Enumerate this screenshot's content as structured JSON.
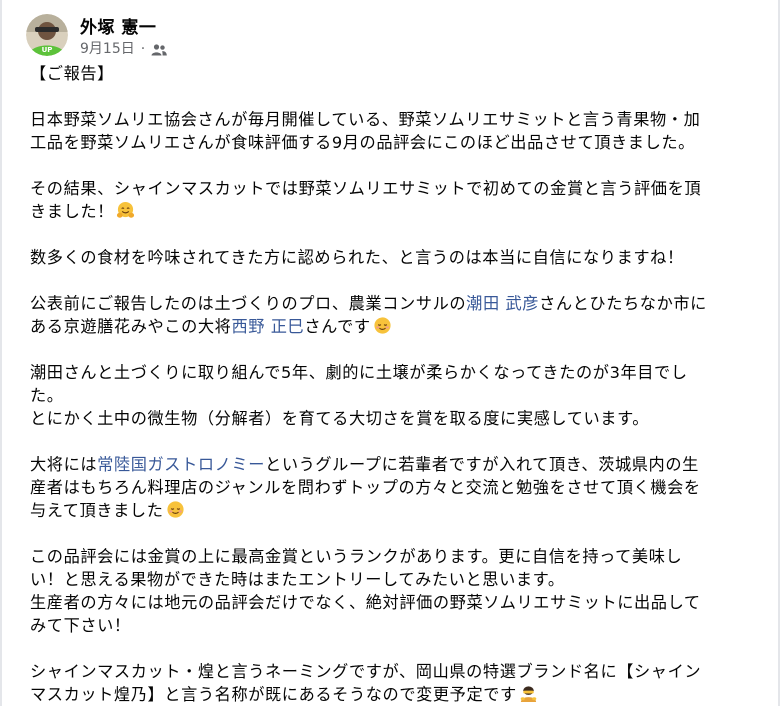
{
  "post": {
    "author": "外塚 憲一",
    "date": "9月15日",
    "separator": "·",
    "audience_icon": "friends-icon",
    "avatar_badge": "UP"
  },
  "content": {
    "p0": "【ご報告】",
    "p1a": "日本野菜ソムリエ協会さんが毎月開催している、野菜ソムリエサミットと言う青果物・加",
    "p1b": "工品を野菜ソムリエさんが食味評価する9月の品評会にこのほど出品させて頂きました。",
    "p2a": "その結果、シャインマスカットでは野菜ソムリエサミットで初めての金賞と言う評価を頂",
    "p2b": "きました！",
    "p3": "数多くの食材を吟味されてきた方に認められた、と言うのは本当に自信になりますね！",
    "p4a_pre": "公表前にご報告したのは土づくりのプロ、農業コンサルの",
    "p4a_link": "潮田 武彦",
    "p4a_post": "さんとひたちなか市に",
    "p4b_pre": "ある京遊膳花みやこの大将",
    "p4b_link": "西野 正巳",
    "p4b_post": "さんです",
    "p5a": "潮田さんと土づくりに取り組んで5年、劇的に土壌が柔らかくなってきたのが3年目でし",
    "p5b": "た。",
    "p5c": "とにかく土中の微生物（分解者）を育てる大切さを賞を取る度に実感しています。",
    "p6a_pre": "大将には",
    "p6a_link": "常陸国ガストロノミー",
    "p6a_post": "というグループに若輩者ですが入れて頂き、茨城県内の生",
    "p6b": "産者はもちろん料理店のジャンルを問わずトップの方々と交流と勉強をさせて頂く機会を",
    "p6c": "与えて頂きました",
    "p7a": "この品評会には金賞の上に最高金賞というランクがあります。更に自信を持って美味し",
    "p7b": "い！と思える果物ができた時はまたエントリーしてみたいと思います。",
    "p7c": "生産者の方々には地元の品評会だけでなく、絶対評価の野菜ソムリエサミットに出品して",
    "p7d": "みて下さい！",
    "p8a": "シャインマスカット・煌と言うネーミングですが、岡山県の特選ブランド名に【シャイン",
    "p8b": "マスカット煌乃】と言う名称が既にあるそうなので変更予定です"
  },
  "emojis": {
    "hugging": "hugging-face-emoji",
    "relieved": "relieved-face-emoji",
    "bowing": "bowing-person-emoji"
  },
  "colors": {
    "link": "#385898",
    "text": "#050505",
    "meta": "#65676b",
    "avatar_green": "#5cc23a"
  }
}
